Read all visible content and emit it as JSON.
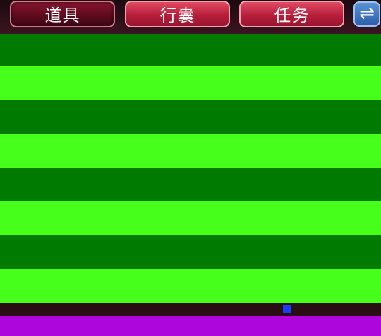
{
  "tabs": [
    {
      "label": "道具",
      "state": "active"
    },
    {
      "label": "行囊",
      "state": "inactive"
    },
    {
      "label": "任务",
      "state": "inactive"
    }
  ],
  "swap_button": {
    "icon": "swap-arrows-icon",
    "glyph": "⇌"
  },
  "colors": {
    "stripe_dark": "#007a00",
    "stripe_light": "#46ff1a",
    "bottom_bar": "#ad06dc",
    "tab_active": "#6a0f24",
    "tab_inactive": "#c9253f",
    "swap_button": "#3d74c0"
  },
  "stripes": [
    "dark",
    "light",
    "dark",
    "light",
    "dark",
    "light",
    "dark",
    "light"
  ]
}
